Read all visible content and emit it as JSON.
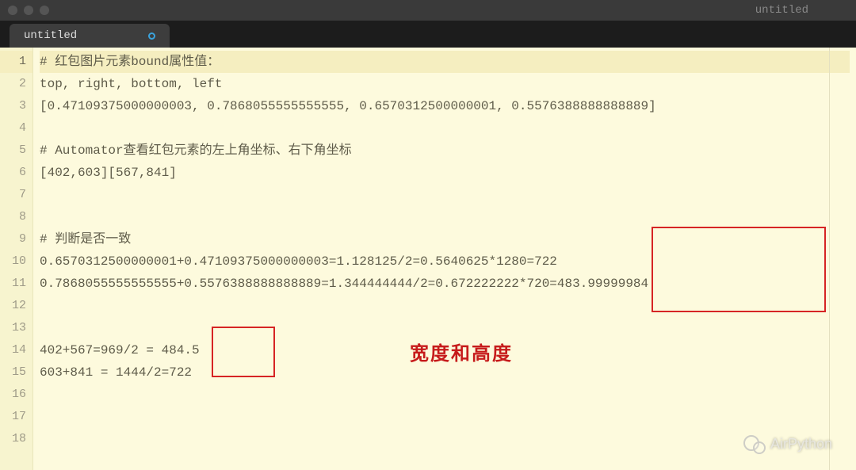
{
  "window": {
    "title": "untitled"
  },
  "tab": {
    "label": "untitled",
    "modified": true
  },
  "editor": {
    "current_line": 1,
    "lines": [
      "# 红包图片元素bound属性值：",
      "top, right, bottom, left",
      "[0.47109375000000003, 0.7868055555555555, 0.6570312500000001, 0.5576388888888889]",
      "",
      "# Automator查看红包元素的左上角坐标、右下角坐标",
      "[402,603][567,841]",
      "",
      "",
      "# 判断是否一致",
      "0.6570312500000001+0.47109375000000003=1.128125/2=0.5640625*1280=722",
      "0.7868055555555555+0.5576388888888889=1.344444444/2=0.672222222*720=483.99999984",
      "",
      "",
      "402+567=969/2 = 484.5",
      "603+841 = 1444/2=722",
      "",
      "",
      ""
    ]
  },
  "annotations": {
    "label": "宽度和高度"
  },
  "watermark": {
    "text": "AirPython"
  }
}
